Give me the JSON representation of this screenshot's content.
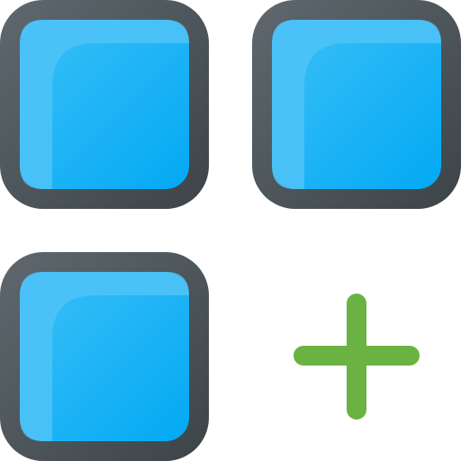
{
  "icon": {
    "name": "add-app-grid-icon",
    "tiles": [
      {
        "name": "tile-top-left"
      },
      {
        "name": "tile-top-right"
      },
      {
        "name": "tile-bottom-left"
      }
    ],
    "add_symbol": "plus-icon",
    "colors": {
      "frame": "#474f54",
      "frame_highlight": "#5f686e",
      "tile_fill": "#03a9f4",
      "tile_fill_light": "#4fc3f7",
      "plus": "#6ab343"
    }
  }
}
